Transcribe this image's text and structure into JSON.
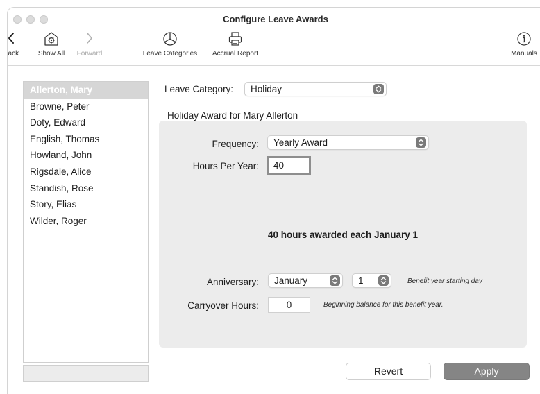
{
  "window": {
    "title": "Configure Leave Awards"
  },
  "toolbar": {
    "back": "Back",
    "show_all": "Show All",
    "forward": "Forward",
    "leave_categories": "Leave Categories",
    "accrual_report": "Accrual Report",
    "manuals": "Manuals"
  },
  "employees": {
    "selected": "Allerton, Mary",
    "items": [
      "Allerton, Mary",
      "Browne, Peter",
      "Doty, Edward",
      "English, Thomas",
      "Howland, John",
      "Rigsdale, Alice",
      "Standish, Rose",
      "Story, Elias",
      "Wilder, Roger"
    ]
  },
  "leave_category": {
    "label": "Leave Category:",
    "value": "Holiday"
  },
  "award_heading": "Holiday Award for Mary Allerton",
  "frequency": {
    "label": "Frequency:",
    "value": "Yearly Award"
  },
  "hours_per_year": {
    "label": "Hours Per Year:",
    "value": "40"
  },
  "summary": "40 hours awarded each January 1",
  "anniversary": {
    "label": "Anniversary:",
    "month": "January",
    "day": "1",
    "hint": "Benefit year starting day"
  },
  "carryover": {
    "label": "Carryover Hours:",
    "value": "0",
    "hint": "Beginning balance for this benefit year."
  },
  "buttons": {
    "revert": "Revert",
    "apply": "Apply"
  },
  "colors": {
    "selection": "#d6d6d6",
    "group_box": "#ececec",
    "apply": "#858585"
  }
}
